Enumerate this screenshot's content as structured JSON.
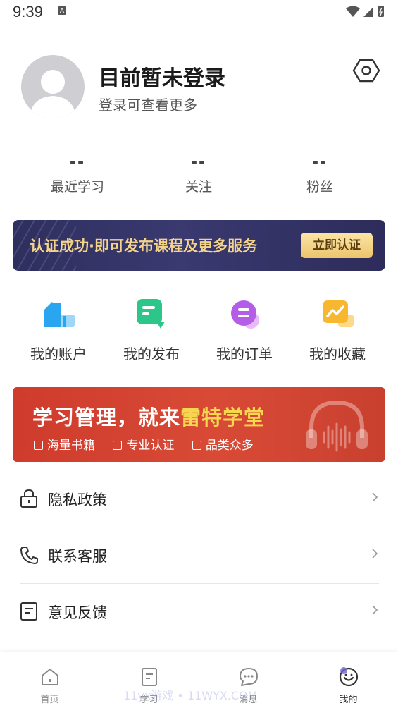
{
  "status_bar": {
    "time": "9:39",
    "notification_badge": "A"
  },
  "profile": {
    "title": "目前暂未登录",
    "subtitle": "登录可查看更多",
    "icons": {
      "avatar": "user-avatar-placeholder",
      "settings": "settings-hexagon-icon"
    }
  },
  "stats": [
    {
      "value": "--",
      "label": "最近学习"
    },
    {
      "value": "--",
      "label": "关注"
    },
    {
      "value": "--",
      "label": "粉丝"
    }
  ],
  "cert_banner": {
    "text": "认证成功·即可发布课程及更多服务",
    "button": "立即认证"
  },
  "quick_actions": [
    {
      "label": "我的账户",
      "icon": "account-house-icon",
      "color": "#2aa5f0"
    },
    {
      "label": "我的发布",
      "icon": "publish-chat-icon",
      "color": "#2cc58a"
    },
    {
      "label": "我的订单",
      "icon": "order-bubble-icon",
      "color": "#b45ee8"
    },
    {
      "label": "我的收藏",
      "icon": "collection-chart-icon",
      "color": "#f7b731"
    }
  ],
  "promo_banner": {
    "title_main": "学习管理，就来",
    "title_highlight": "雷特学堂",
    "features": [
      "海量书籍",
      "专业认证",
      "品类众多"
    ],
    "icon": "headphones-icon"
  },
  "menu": [
    {
      "label": "隐私政策",
      "icon": "lock-icon"
    },
    {
      "label": "联系客服",
      "icon": "phone-icon"
    },
    {
      "label": "意见反馈",
      "icon": "feedback-document-icon"
    }
  ],
  "tabs": [
    {
      "label": "首页",
      "icon": "home-icon"
    },
    {
      "label": "学习",
      "icon": "study-document-icon"
    },
    {
      "label": "消息",
      "icon": "message-icon"
    },
    {
      "label": "我的",
      "icon": "profile-face-icon",
      "active": true
    }
  ],
  "watermark": "11yx游戏 • 11WYX.COM",
  "colors": {
    "accent_gold": "#f3d48a",
    "banner_dark": "#2f2f5e",
    "promo_red": "#cf3b2c"
  }
}
